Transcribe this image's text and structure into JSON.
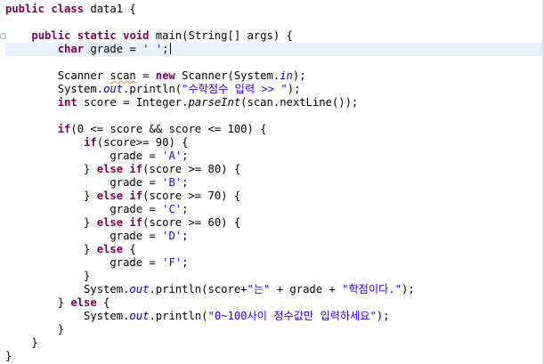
{
  "editor": {
    "lines": [
      {
        "segs": [
          [
            "kw",
            "public"
          ],
          [
            "",
            ""
          ],
          [
            "kw",
            " class"
          ],
          [
            "",
            " data1 {"
          ]
        ]
      },
      {
        "segs": []
      },
      {
        "segs": [
          [
            "",
            "    "
          ],
          [
            "kw",
            "public"
          ],
          [
            "",
            ""
          ],
          [
            "kw",
            " static"
          ],
          [
            "",
            ""
          ],
          [
            "kw",
            " void"
          ],
          [
            "",
            " main(String[] args) {"
          ]
        ]
      },
      {
        "segs": [
          [
            "",
            "        "
          ],
          [
            "kw",
            "char"
          ],
          [
            "",
            " grade = "
          ],
          [
            "str",
            "' '"
          ],
          [
            "",
            ";"
          ]
        ],
        "current": true
      },
      {
        "segs": []
      },
      {
        "segs": [
          [
            "",
            "        Scanner "
          ],
          [
            "warn",
            "scan"
          ],
          [
            "",
            " = "
          ],
          [
            "kw",
            "new"
          ],
          [
            "",
            " Scanner(System."
          ],
          [
            "fld",
            "in"
          ],
          [
            "",
            ");"
          ]
        ]
      },
      {
        "segs": [
          [
            "",
            "        System."
          ],
          [
            "fld",
            "out"
          ],
          [
            "",
            ".println("
          ],
          [
            "str",
            "\"수학점수 입력 >> \""
          ],
          [
            "",
            ");"
          ]
        ]
      },
      {
        "segs": [
          [
            "",
            "        "
          ],
          [
            "kw",
            "int"
          ],
          [
            "",
            " score = Integer."
          ],
          [
            "ita",
            "parseInt"
          ],
          [
            "",
            "(scan.nextLine());"
          ]
        ]
      },
      {
        "segs": []
      },
      {
        "segs": [
          [
            "",
            "        "
          ],
          [
            "kw",
            "if"
          ],
          [
            "",
            "(0 <= score && score <= 100) {"
          ]
        ]
      },
      {
        "segs": [
          [
            "",
            "            "
          ],
          [
            "kw",
            "if"
          ],
          [
            "",
            "(score>= 90) {"
          ]
        ]
      },
      {
        "segs": [
          [
            "",
            "                grade = "
          ],
          [
            "str",
            "'A'"
          ],
          [
            "",
            ";"
          ]
        ]
      },
      {
        "segs": [
          [
            "",
            "            } "
          ],
          [
            "kw",
            "else"
          ],
          [
            "",
            ""
          ],
          [
            "kw",
            " if"
          ],
          [
            "",
            "(score >= 80) {"
          ]
        ]
      },
      {
        "segs": [
          [
            "",
            "                grade = "
          ],
          [
            "str",
            "'B'"
          ],
          [
            "",
            ";"
          ]
        ]
      },
      {
        "segs": [
          [
            "",
            "            } "
          ],
          [
            "kw",
            "else"
          ],
          [
            "",
            ""
          ],
          [
            "kw",
            " if"
          ],
          [
            "",
            "(score >= 70) {"
          ]
        ]
      },
      {
        "segs": [
          [
            "",
            "                grade = "
          ],
          [
            "str",
            "'C'"
          ],
          [
            "",
            ";"
          ]
        ]
      },
      {
        "segs": [
          [
            "",
            "            } "
          ],
          [
            "kw",
            "else"
          ],
          [
            "",
            ""
          ],
          [
            "kw",
            " if"
          ],
          [
            "",
            "(score >= 60) {"
          ]
        ]
      },
      {
        "segs": [
          [
            "",
            "                grade = "
          ],
          [
            "str",
            "'D'"
          ],
          [
            "",
            ";"
          ]
        ]
      },
      {
        "segs": [
          [
            "",
            "            } "
          ],
          [
            "kw",
            "else"
          ],
          [
            "",
            " {"
          ]
        ]
      },
      {
        "segs": [
          [
            "",
            "                grade = "
          ],
          [
            "str",
            "'F'"
          ],
          [
            "",
            ";"
          ]
        ]
      },
      {
        "segs": [
          [
            "",
            "            }"
          ]
        ]
      },
      {
        "segs": [
          [
            "",
            "            System."
          ],
          [
            "fld",
            "out"
          ],
          [
            "",
            ".println(score+"
          ],
          [
            "str",
            "\"는\""
          ],
          [
            "",
            " + grade + "
          ],
          [
            "str",
            "\"학점이다.\""
          ],
          [
            "",
            ");"
          ]
        ]
      },
      {
        "segs": [
          [
            "",
            "        } "
          ],
          [
            "kw",
            "else"
          ],
          [
            "",
            " {"
          ]
        ]
      },
      {
        "segs": [
          [
            "",
            "            System."
          ],
          [
            "fld",
            "out"
          ],
          [
            "",
            ".println("
          ],
          [
            "str",
            "\"0~100사이 정수값만 입력하세요\""
          ],
          [
            "",
            ");"
          ]
        ]
      },
      {
        "segs": [
          [
            "",
            "        }"
          ]
        ]
      },
      {
        "segs": [
          [
            "",
            "    }"
          ]
        ]
      },
      {
        "segs": [
          [
            "",
            "}"
          ]
        ]
      }
    ]
  }
}
